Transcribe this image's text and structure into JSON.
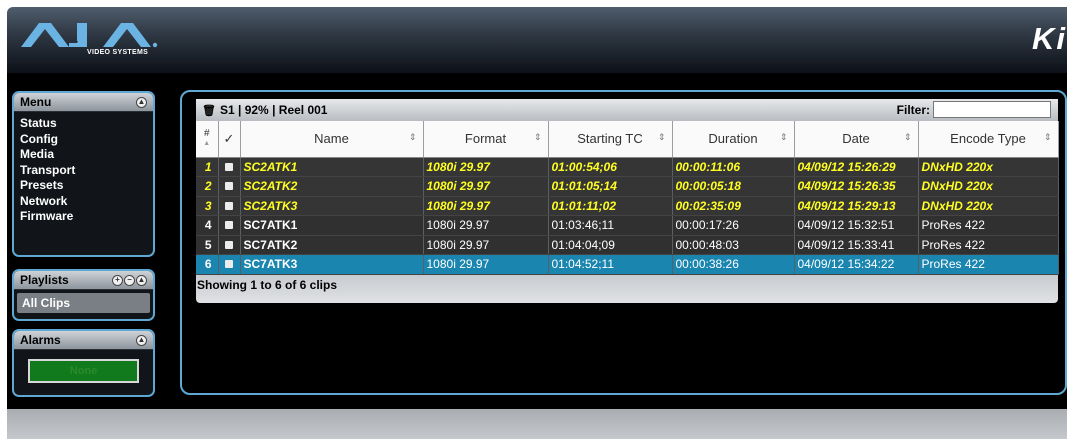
{
  "header": {
    "logo_text": "AJA",
    "logo_subtitle": "VIDEO SYSTEMS",
    "product_partial": "Ki"
  },
  "menu": {
    "title": "Menu",
    "items": [
      "Status",
      "Config",
      "Media",
      "Transport",
      "Presets",
      "Network",
      "Firmware"
    ]
  },
  "playlists": {
    "title": "Playlists",
    "items": [
      "All Clips"
    ]
  },
  "alarms": {
    "title": "Alarms",
    "status": "None"
  },
  "clip_panel": {
    "drive": "S1",
    "capacity": "92%",
    "reel": "Reel 001",
    "separator": "|",
    "filter_label": "Filter:",
    "filter_value": "",
    "columns": [
      "#",
      "✓",
      "Name",
      "Format",
      "Starting TC",
      "Duration",
      "Date",
      "Encode Type"
    ],
    "rows": [
      {
        "num": "1",
        "name": "SC2ATK1",
        "format": "1080i 29.97",
        "start_tc": "01:00:54;06",
        "duration": "00:00:11:06",
        "date": "04/09/12 15:26:29",
        "encode": "DNxHD 220x",
        "style": "yellow"
      },
      {
        "num": "2",
        "name": "SC2ATK2",
        "format": "1080i 29.97",
        "start_tc": "01:01:05;14",
        "duration": "00:00:05:18",
        "date": "04/09/12 15:26:35",
        "encode": "DNxHD 220x",
        "style": "yellow"
      },
      {
        "num": "3",
        "name": "SC2ATK3",
        "format": "1080i 29.97",
        "start_tc": "01:01:11;02",
        "duration": "00:02:35:09",
        "date": "04/09/12 15:29:13",
        "encode": "DNxHD 220x",
        "style": "yellow"
      },
      {
        "num": "4",
        "name": "SC7ATK1",
        "format": "1080i 29.97",
        "start_tc": "01:03:46;11",
        "duration": "00:00:17:26",
        "date": "04/09/12 15:32:51",
        "encode": "ProRes 422",
        "style": "normal"
      },
      {
        "num": "5",
        "name": "SC7ATK2",
        "format": "1080i 29.97",
        "start_tc": "01:04:04;09",
        "duration": "00:00:48:03",
        "date": "04/09/12 15:33:41",
        "encode": "ProRes 422",
        "style": "normal"
      },
      {
        "num": "6",
        "name": "SC7ATK3",
        "format": "1080i 29.97",
        "start_tc": "01:04:52;11",
        "duration": "00:00:38:26",
        "date": "04/09/12 15:34:22",
        "encode": "ProRes 422",
        "style": "selected"
      }
    ],
    "status_text": "Showing 1 to 6 of 6 clips"
  },
  "colors": {
    "accent": "#5fa8d3",
    "selected_row": "#1a86b0",
    "highlight_text": "#ffff22",
    "alarm_ok": "#117a1c"
  }
}
